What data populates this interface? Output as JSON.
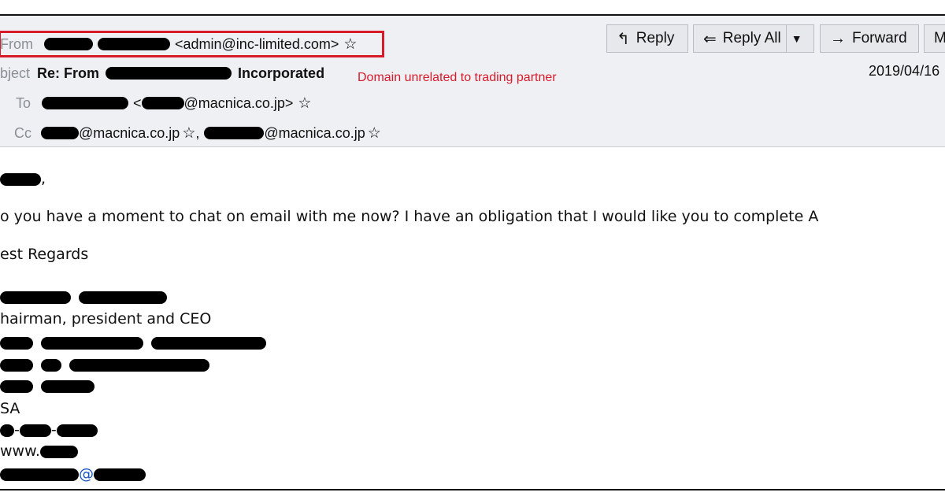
{
  "header": {
    "from": {
      "label": "From",
      "email": "<admin@inc-limited.com>"
    },
    "subject": {
      "label": "bject",
      "prefix": "Re: From",
      "suffix": "Incorporated"
    },
    "to": {
      "label": "To",
      "email_start": "<",
      "email_end": "@macnica.co.jp>"
    },
    "cc": {
      "label": "Cc",
      "email1_end": "@macnica.co.jp",
      "separator": ",",
      "email2_end": "@macnica.co.jp"
    },
    "date": "2019/04/16",
    "annotation": "Domain unrelated to trading partner"
  },
  "toolbar": {
    "reply": "Reply",
    "reply_all": "Reply All",
    "forward": "Forward",
    "more": "M"
  },
  "body": {
    "greeting_suffix": ",",
    "message": "o you have a moment to chat on email with me now? I have an obligation that I would like you to complete A",
    "closing": "est Regards",
    "sig_title": "hairman, president and CEO",
    "sig_country": "SA",
    "sig_phone_sep1": "-",
    "sig_phone_sep2": "-",
    "sig_web": "www.",
    "sig_email_at": "@"
  }
}
